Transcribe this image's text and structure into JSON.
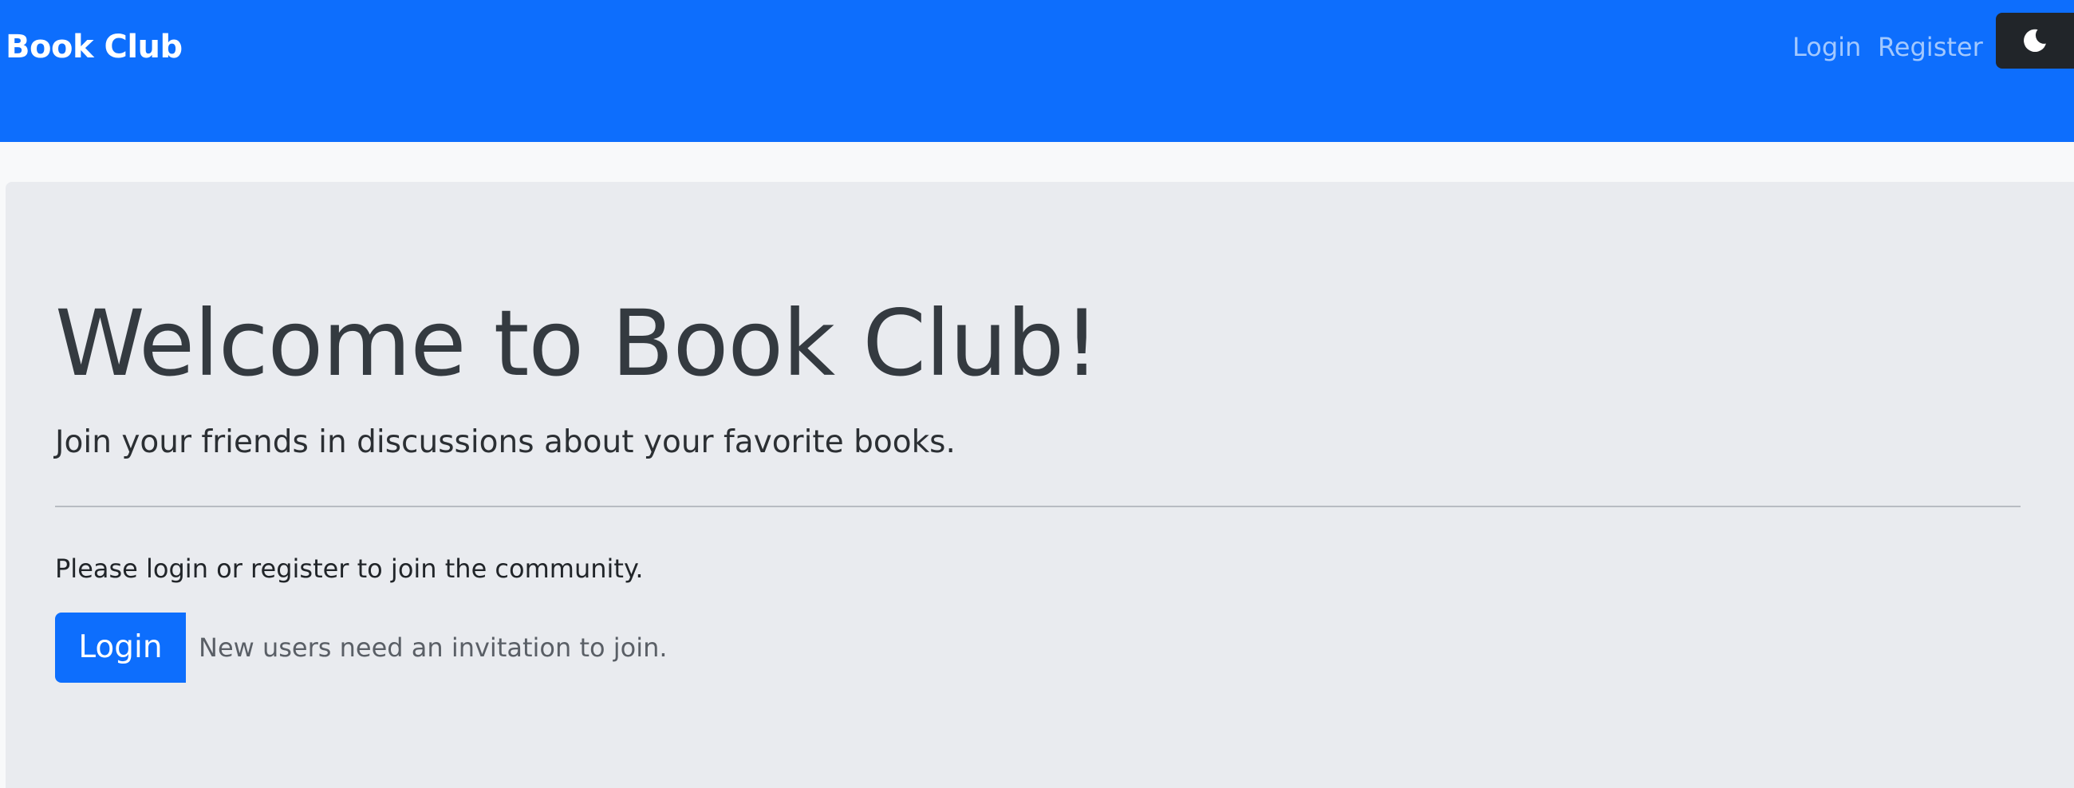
{
  "navbar": {
    "brand": "Book Club",
    "links": {
      "login": "Login",
      "register": "Register"
    },
    "theme_toggle_icon": "moon-icon",
    "background_color": "#0d6efd"
  },
  "hero": {
    "title": "Welcome to Book Club!",
    "lead": "Join your friends in discussions about your favorite books.",
    "prompt": "Please login or register to join the community.",
    "login_button": "Login",
    "invite_note": "New users need an invitation to join."
  },
  "colors": {
    "primary": "#0d6efd",
    "dark_button": "#212529",
    "panel": "#e9ebef",
    "page_bg": "#f8f9fa"
  }
}
